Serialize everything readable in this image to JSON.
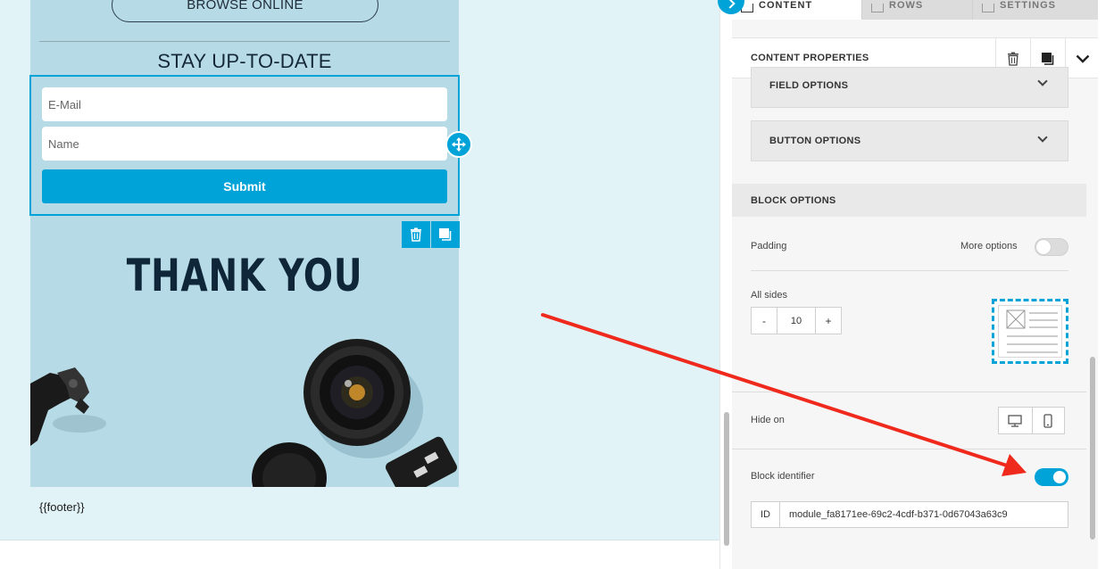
{
  "canvas": {
    "browse_label": "BROWSE ONLINE",
    "stay_title": "STAY UP-TO-DATE",
    "email_placeholder": "E-Mail",
    "name_placeholder": "Name",
    "submit_label": "Submit",
    "thank_you": "THANK YOU",
    "footer": "{{footer}}"
  },
  "tabs": [
    {
      "label": "CONTENT",
      "active": true
    },
    {
      "label": "ROWS",
      "active": false
    },
    {
      "label": "SETTINGS",
      "active": false
    }
  ],
  "panel": {
    "title": "CONTENT PROPERTIES",
    "field_options": "FIELD OPTIONS",
    "button_options": "BUTTON OPTIONS",
    "block_options": "BLOCK OPTIONS",
    "padding_label": "Padding",
    "more_options_label": "More options",
    "more_options_on": false,
    "all_sides_label": "All sides",
    "padding_value": "10",
    "minus": "-",
    "plus": "+",
    "hide_on_label": "Hide on",
    "block_identifier_label": "Block identifier",
    "block_identifier_on": true,
    "id_label": "ID",
    "id_value": "module_fa8171ee-69c2-4cdf-b371-0d67043a63c9"
  },
  "colors": {
    "accent": "#00a3d8",
    "annotation_arrow": "#f0291d",
    "canvas_bg": "#e2f3f8",
    "email_bg": "#b7dbe6",
    "heading": "#0f2638"
  },
  "icons": [
    "move-icon",
    "trash-icon",
    "duplicate-icon",
    "chevron-down-icon",
    "desktop-icon",
    "mobile-icon",
    "chevron-right-icon",
    "grid-icon"
  ]
}
